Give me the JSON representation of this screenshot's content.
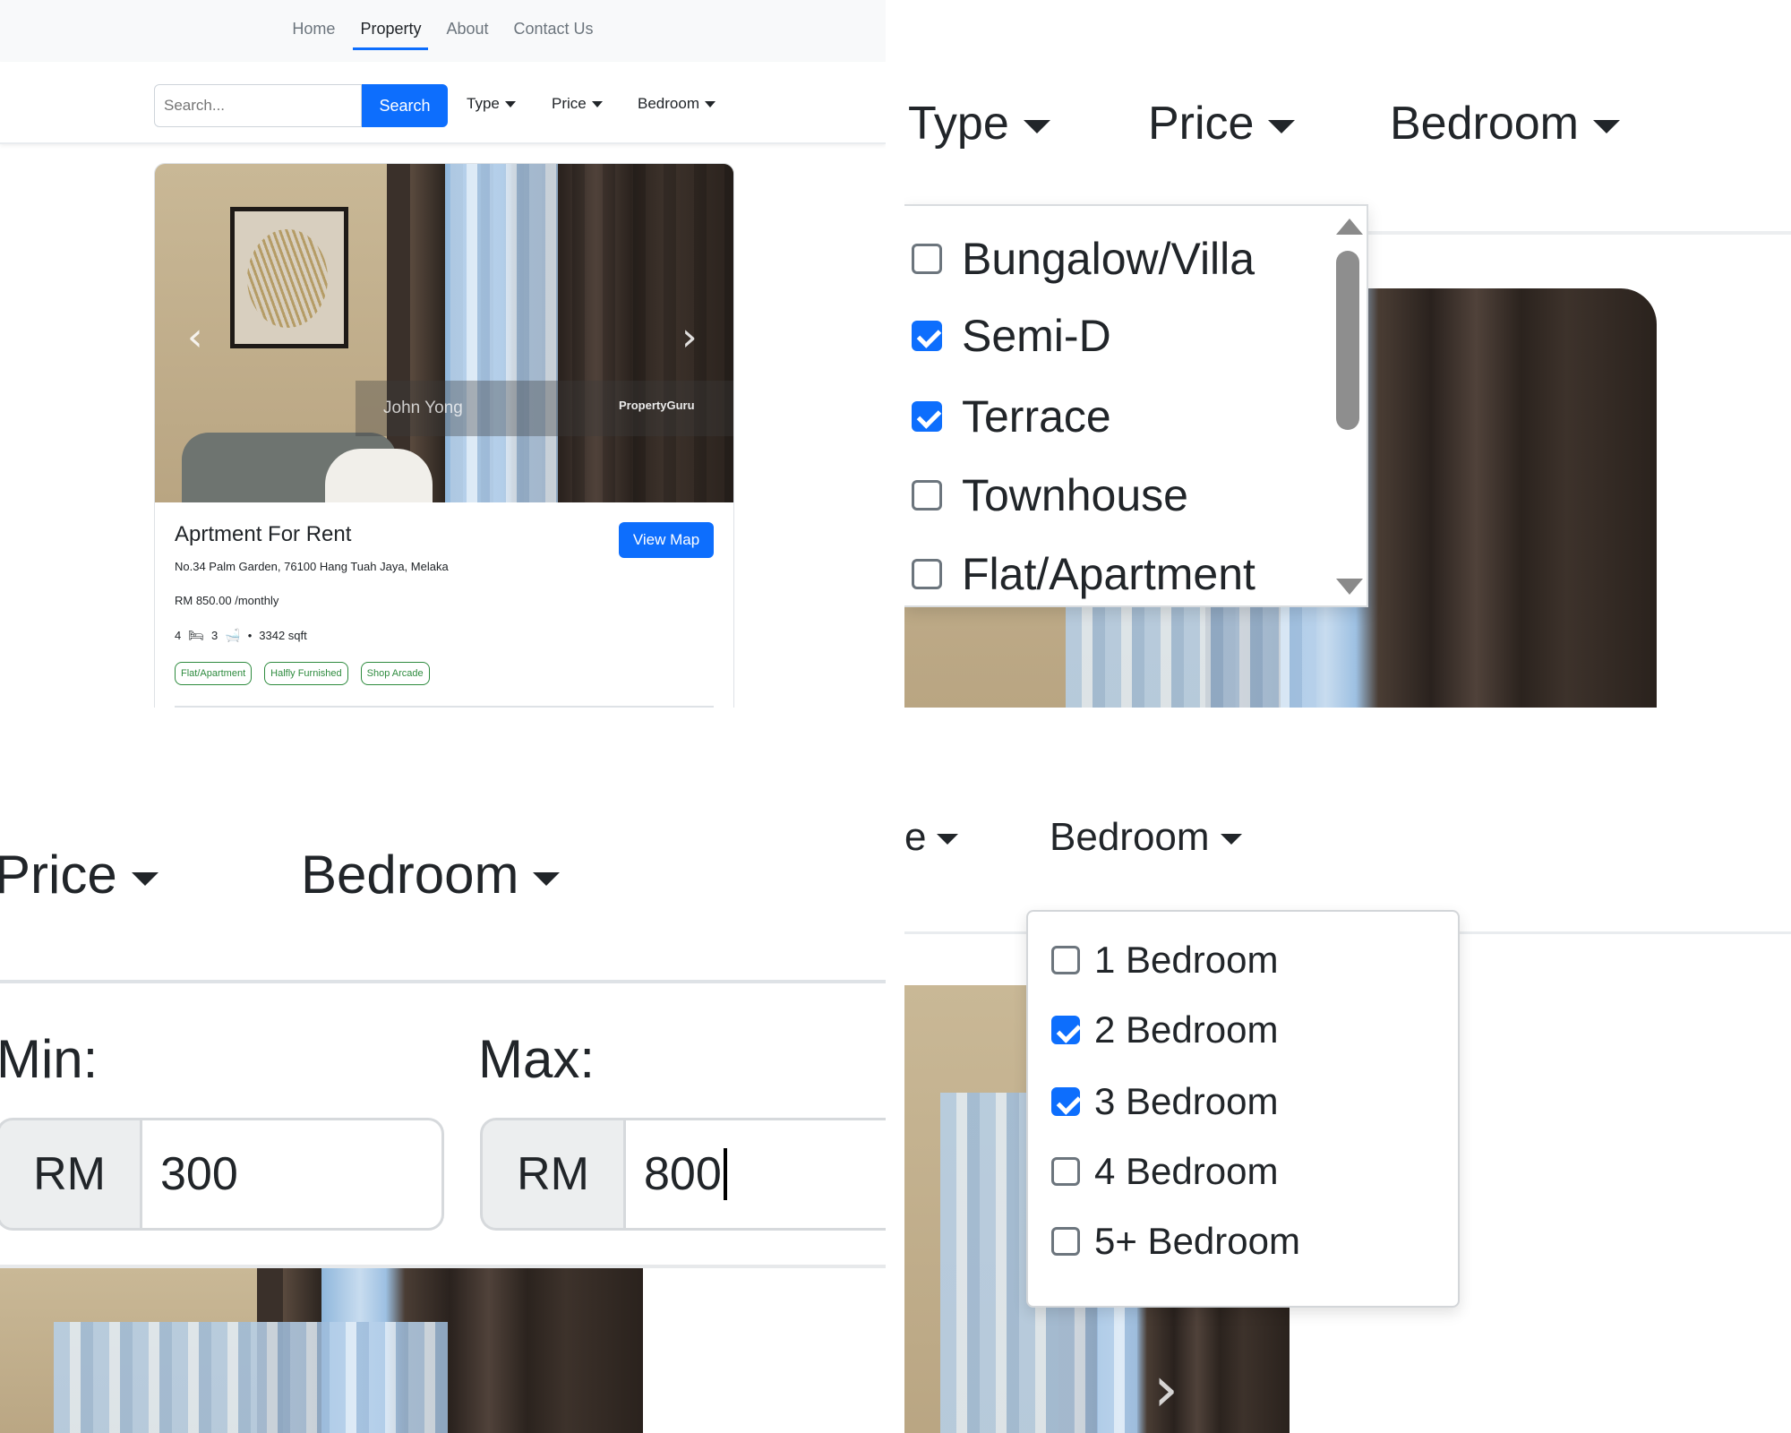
{
  "panel1": {
    "nav": {
      "home": "Home",
      "property": "Property",
      "about": "About",
      "contact": "Contact Us"
    },
    "search": {
      "placeholder": "Search...",
      "button": "Search"
    },
    "filters": {
      "type": "Type",
      "price": "Price",
      "bedroom": "Bedroom"
    },
    "card": {
      "photo_watermark_name": "John Yong",
      "photo_watermark_logo": "PropertyGuru",
      "title": "Aprtment For Rent",
      "view_map": "View Map",
      "address": "No.34 Palm Garden, 76100 Hang Tuah Jaya, Melaka",
      "price": "RM 850.00 /monthly",
      "bedrooms": "4",
      "bathrooms": "3",
      "area": "3342 sqft",
      "tags": [
        "Flat/Apartment",
        "Halfly Furnished",
        "Shop Arcade"
      ]
    }
  },
  "panel2": {
    "filters": {
      "type": "Type",
      "price": "Price",
      "bedroom": "Bedroom"
    },
    "type_options": [
      {
        "label": "Bungalow/Villa",
        "checked": false
      },
      {
        "label": "Semi-D",
        "checked": true
      },
      {
        "label": "Terrace",
        "checked": true
      },
      {
        "label": "Townhouse",
        "checked": false
      },
      {
        "label": "Flat/Apartment",
        "checked": false
      }
    ]
  },
  "panel3": {
    "filters": {
      "price": "Price",
      "bedroom": "Bedroom"
    },
    "min_label": "Min:",
    "max_label": "Max:",
    "currency": "RM",
    "min_value": "300",
    "max_value": "800"
  },
  "panel4": {
    "filters": {
      "price_partial": "e",
      "bedroom": "Bedroom"
    },
    "bedroom_options": [
      {
        "label": "1 Bedroom",
        "checked": false
      },
      {
        "label": "2 Bedroom",
        "checked": true
      },
      {
        "label": "3 Bedroom",
        "checked": true
      },
      {
        "label": "4 Bedroom",
        "checked": false
      },
      {
        "label": "5+ Bedroom",
        "checked": false
      }
    ]
  },
  "colors": {
    "primary": "#0d6efd",
    "tag_green": "#2e8b3e"
  }
}
